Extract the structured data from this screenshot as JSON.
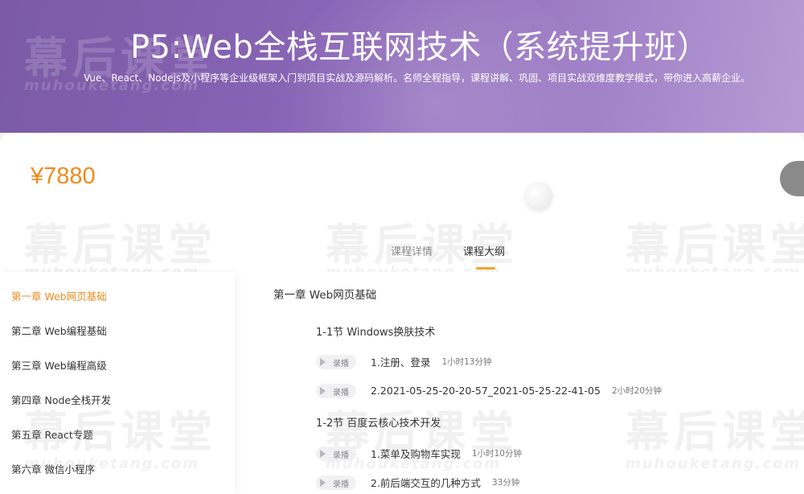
{
  "banner": {
    "title": "P5:Web全栈互联网技术（系统提升班）",
    "subtitle": "Vue、React、Nodejs及小程序等企业级框架入门到项目实战及源码解析。名师全程指导，课程讲解、巩固、项目实战双维度教学模式，带你进入高薪企业。"
  },
  "price": "¥7880",
  "tabs": [
    {
      "label": "课程详情",
      "active": false
    },
    {
      "label": "课程大纲",
      "active": true
    }
  ],
  "sidebar": {
    "items": [
      {
        "label": "第一章 Web网页基础",
        "active": true
      },
      {
        "label": "第二章 Web编程基础"
      },
      {
        "label": "第三章 Web编程高级"
      },
      {
        "label": "第四章 Node全栈开发"
      },
      {
        "label": "第五章 React专题"
      },
      {
        "label": "第六章 微信小程序"
      }
    ]
  },
  "content": {
    "chapter_title": "第一章 Web网页基础",
    "sections": [
      {
        "title": "1-1节 Windows换肤技术",
        "lessons": [
          {
            "badge": "录播",
            "name": "1.注册、登录",
            "duration": "1小时13分钟"
          },
          {
            "badge": "录播",
            "name": "2.2021-05-25-20-20-57_2021-05-25-22-41-05",
            "duration": "2小时20分钟"
          }
        ]
      },
      {
        "title": "1-2节 百度云核心技术开发",
        "lessons": [
          {
            "badge": "录播",
            "name": "1.菜单及购物车实现",
            "duration": "1小时10分钟"
          },
          {
            "badge": "录播",
            "name": "2.前后端交互的几种方式",
            "duration": "33分钟"
          }
        ]
      }
    ]
  },
  "watermark": {
    "text": "幕后课堂",
    "url": "muhouketang.com"
  },
  "colors": {
    "banner_start": "#7b5aa6",
    "price": "#f08a1c",
    "tab_underline": "#f5a623",
    "active_sidebar": "#f08a1c"
  },
  "icons": {
    "play": "play-icon"
  }
}
